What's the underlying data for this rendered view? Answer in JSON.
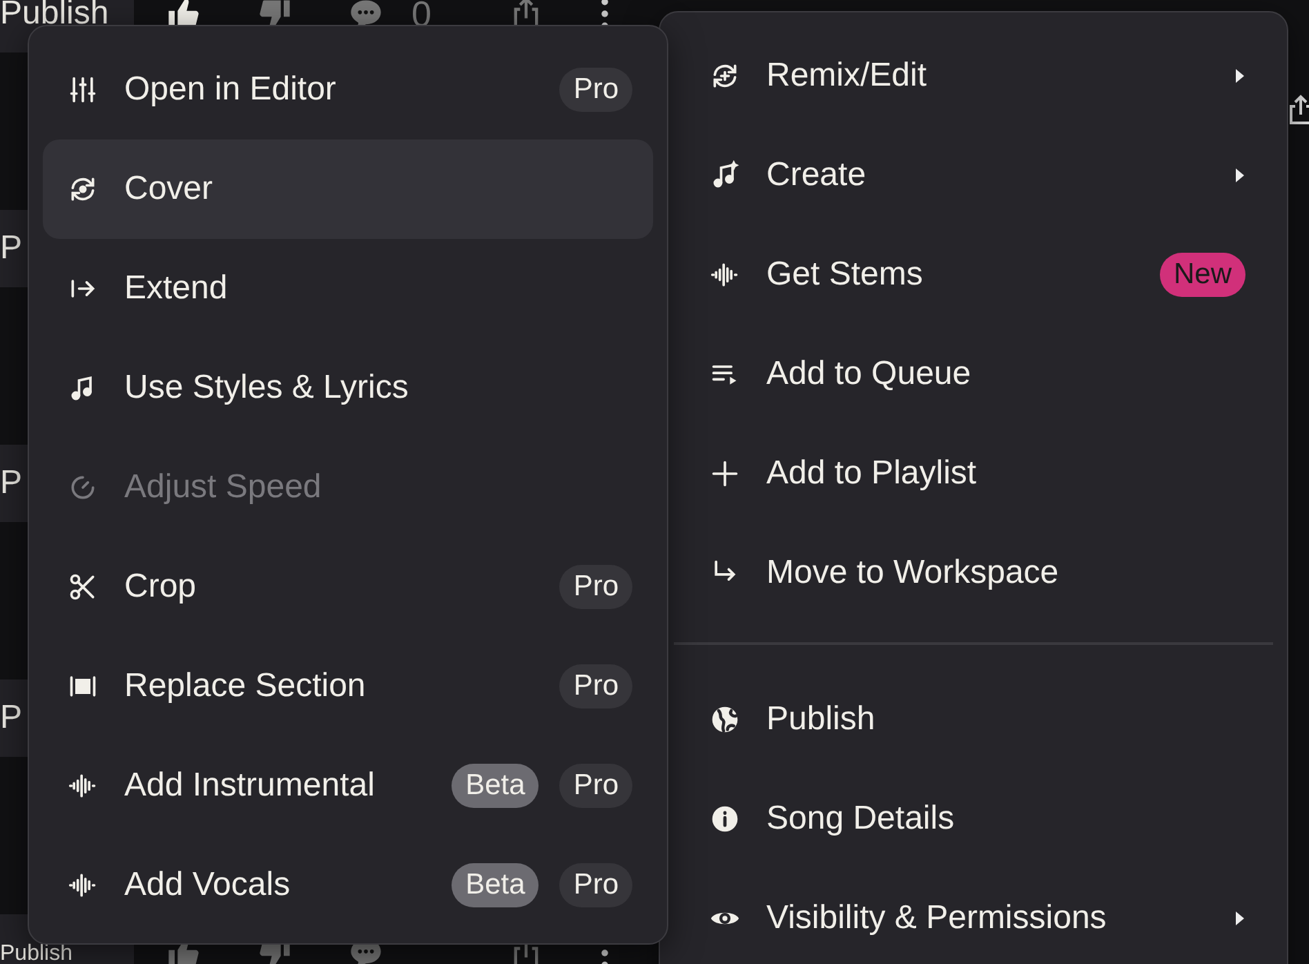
{
  "background_rows": [
    {
      "label": "Publish",
      "liked": true,
      "comment_count": "0"
    },
    {
      "label": "P"
    },
    {
      "label": "P"
    },
    {
      "label": "P"
    },
    {
      "label": "Publish",
      "liked": false
    }
  ],
  "submenu": {
    "items": [
      {
        "label": "Open in Editor",
        "selected": false,
        "disabled": false,
        "badges": [
          {
            "kind": "pro",
            "text": "Pro"
          }
        ]
      },
      {
        "label": "Cover",
        "selected": true,
        "disabled": false
      },
      {
        "label": "Extend",
        "selected": false,
        "disabled": false
      },
      {
        "label": "Use Styles & Lyrics",
        "selected": false,
        "disabled": false
      },
      {
        "label": "Adjust Speed",
        "selected": false,
        "disabled": true
      },
      {
        "label": "Crop",
        "selected": false,
        "disabled": false,
        "badges": [
          {
            "kind": "pro",
            "text": "Pro"
          }
        ]
      },
      {
        "label": "Replace Section",
        "selected": false,
        "disabled": false,
        "badges": [
          {
            "kind": "pro",
            "text": "Pro"
          }
        ]
      },
      {
        "label": "Add Instrumental",
        "selected": false,
        "disabled": false,
        "badges": [
          {
            "kind": "beta",
            "text": "Beta"
          },
          {
            "kind": "pro",
            "text": "Pro"
          }
        ]
      },
      {
        "label": "Add Vocals",
        "selected": false,
        "disabled": false,
        "badges": [
          {
            "kind": "beta",
            "text": "Beta"
          },
          {
            "kind": "pro",
            "text": "Pro"
          }
        ]
      }
    ]
  },
  "menu": {
    "groups": [
      [
        {
          "label": "Remix/Edit",
          "has_submenu": true
        },
        {
          "label": "Create",
          "has_submenu": true
        },
        {
          "label": "Get Stems",
          "has_submenu": false,
          "badges": [
            {
              "kind": "new",
              "text": "New"
            }
          ]
        },
        {
          "label": "Add to Queue",
          "has_submenu": false
        },
        {
          "label": "Add to Playlist",
          "has_submenu": false
        },
        {
          "label": "Move to Workspace",
          "has_submenu": false
        }
      ],
      [
        {
          "label": "Publish",
          "has_submenu": false
        },
        {
          "label": "Song Details",
          "has_submenu": false
        },
        {
          "label": "Visibility & Permissions",
          "has_submenu": true
        }
      ]
    ]
  }
}
